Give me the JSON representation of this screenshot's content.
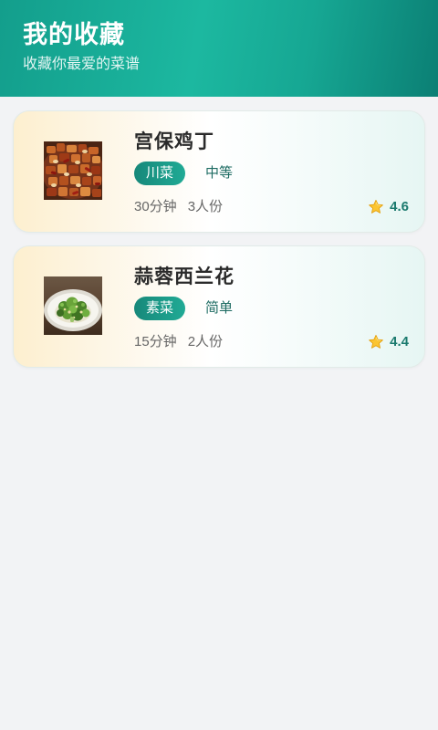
{
  "header": {
    "title": "我的收藏",
    "subtitle": "收藏你最爱的菜谱"
  },
  "favorites": [
    {
      "name": "宫保鸡丁",
      "cuisine": "川菜",
      "difficulty": "中等",
      "time": "30分钟",
      "servings": "3人份",
      "rating": "4.6",
      "photo": "kung-pao-chicken-photo",
      "rating_icon": "star-icon"
    },
    {
      "name": "蒜蓉西兰花",
      "cuisine": "素菜",
      "difficulty": "简单",
      "time": "15分钟",
      "servings": "2人份",
      "rating": "4.4",
      "photo": "garlic-broccoli-photo",
      "rating_icon": "star-icon"
    }
  ],
  "colors": {
    "header_start": "#139e8c",
    "header_end": "#0b7f74",
    "accent": "#17a592",
    "rating_text": "#1b7a6e",
    "star": "#fbc531",
    "page_background": "#f2f3f5"
  }
}
